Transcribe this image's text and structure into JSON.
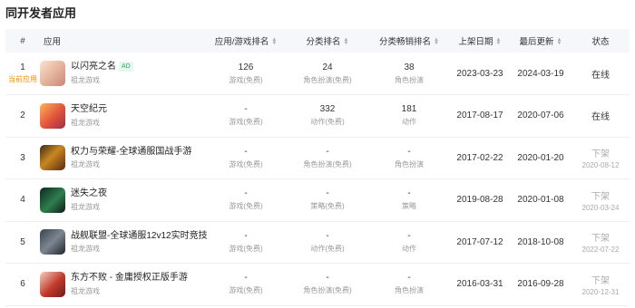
{
  "section": {
    "title": "同开发者应用"
  },
  "columns": {
    "index": "#",
    "app": "应用",
    "app_game_rank": "应用/游戏排名",
    "category_rank": "分类排名",
    "category_grossing_rank": "分类畅销排名",
    "launch_date": "上架日期",
    "last_update": "最后更新",
    "status": "状态"
  },
  "sort_icon": "sort-updown-icon",
  "rows": [
    {
      "index": "1",
      "current_label": "当前应用",
      "icon": "game-icon-yishanliangzhiming",
      "name": "以闪亮之名",
      "badge": "AD",
      "developer": "祖龙游戏",
      "app_game_rank": "126",
      "app_game_rank_sub": "游戏(免费)",
      "category_rank": "24",
      "category_rank_sub": "角色扮演(免费)",
      "grossing_rank": "38",
      "grossing_rank_sub": "角色扮演",
      "launch_date": "2023-03-23",
      "last_update": "2024-03-19",
      "status": "在线",
      "status_date": ""
    },
    {
      "index": "2",
      "current_label": "",
      "icon": "game-icon-tiankongjiyuan",
      "name": "天空纪元",
      "badge": "",
      "developer": "祖龙游戏",
      "app_game_rank": "-",
      "app_game_rank_sub": "游戏(免费)",
      "category_rank": "332",
      "category_rank_sub": "动作(免费)",
      "grossing_rank": "181",
      "grossing_rank_sub": "动作",
      "launch_date": "2017-08-17",
      "last_update": "2020-07-06",
      "status": "在线",
      "status_date": ""
    },
    {
      "index": "3",
      "current_label": "",
      "icon": "game-icon-quanliyurongyao",
      "name": "权力与荣耀-全球通服国战手游",
      "badge": "",
      "developer": "祖龙游戏",
      "app_game_rank": "-",
      "app_game_rank_sub": "游戏(免费)",
      "category_rank": "-",
      "category_rank_sub": "角色扮演(免费)",
      "grossing_rank": "-",
      "grossing_rank_sub": "角色扮演",
      "launch_date": "2017-02-22",
      "last_update": "2020-01-20",
      "status": "下架",
      "status_date": "2020-08-12"
    },
    {
      "index": "4",
      "current_label": "",
      "icon": "game-icon-mishizhiye",
      "name": "迷失之夜",
      "badge": "",
      "developer": "祖龙游戏",
      "app_game_rank": "-",
      "app_game_rank_sub": "游戏(免费)",
      "category_rank": "-",
      "category_rank_sub": "策略(免费)",
      "grossing_rank": "-",
      "grossing_rank_sub": "策略",
      "launch_date": "2019-08-28",
      "last_update": "2020-01-08",
      "status": "下架",
      "status_date": "2020-03-24"
    },
    {
      "index": "5",
      "current_label": "",
      "icon": "game-icon-zhanjianlianmeng",
      "name": "战舰联盟-全球通服12v12实时竞技",
      "badge": "",
      "developer": "祖龙游戏",
      "app_game_rank": "-",
      "app_game_rank_sub": "游戏(免费)",
      "category_rank": "-",
      "category_rank_sub": "动作(免费)",
      "grossing_rank": "-",
      "grossing_rank_sub": "动作",
      "launch_date": "2017-07-12",
      "last_update": "2018-10-08",
      "status": "下架",
      "status_date": "2022-07-22"
    },
    {
      "index": "6",
      "current_label": "",
      "icon": "game-icon-dongfangbubai",
      "name": "东方不败 - 金庸授权正版手游",
      "badge": "",
      "developer": "祖龙游戏",
      "app_game_rank": "-",
      "app_game_rank_sub": "游戏(免费)",
      "category_rank": "-",
      "category_rank_sub": "角色扮演(免费)",
      "grossing_rank": "-",
      "grossing_rank_sub": "角色扮演",
      "launch_date": "2016-03-31",
      "last_update": "2016-09-28",
      "status": "下架",
      "status_date": "2020-12-31"
    }
  ],
  "colors": {
    "header_bg": "#f5f7fa",
    "current_label": "#f29100",
    "ad_badge_text": "#2fa86c",
    "ad_badge_bg": "#e6f7ee",
    "muted_text": "#999999",
    "offline_status": "#aaaaaa"
  }
}
